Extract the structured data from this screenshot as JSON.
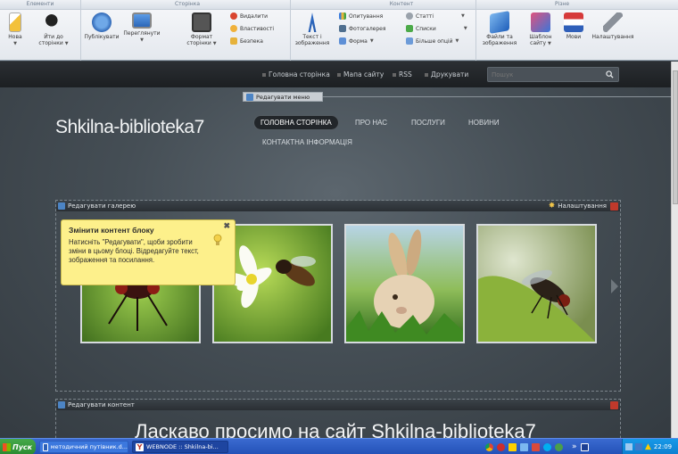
{
  "ribbon": {
    "groups": [
      {
        "label": "Елементи"
      },
      {
        "label": "Сторінка"
      },
      {
        "label": "Контент"
      },
      {
        "label": "Різне"
      }
    ],
    "buttons": {
      "new": "Нова",
      "goto_page": "Йти до сторінки",
      "publish": "Публікувати",
      "preview": "Переглянути",
      "page_format": "Формат сторінки",
      "delete": "Видалити",
      "properties": "Властивості",
      "security": "Безпека",
      "text_images": "Текст і зображення",
      "polls": "Опитування",
      "photogallery": "Фотогалерея",
      "form": "Форма",
      "articles": "Статті",
      "lists": "Списки",
      "more_options": "Більше опцій",
      "files_images": "Файли та зображення",
      "site_template": "Шаблон сайту",
      "languages": "Мови",
      "settings": "Налаштування"
    }
  },
  "site": {
    "toplinks": [
      "Головна сторінка",
      "Мапа сайту",
      "RSS",
      "Друкувати"
    ],
    "search_placeholder": "Пошук",
    "edit_menu": "Редагувати меню",
    "title": "Shkilna-biblioteka7",
    "nav": [
      "ГОЛОВНА СТОРІНКА",
      "ПРО НАС",
      "ПОСЛУГИ",
      "НОВИНИ",
      "КОНТАКТНА ІНФОРМАЦІЯ"
    ],
    "gallery_block": {
      "edit_label": "Редагувати галерею",
      "settings_label": "Налаштування"
    },
    "content_block": {
      "edit_label": "Редагувати контент"
    },
    "tooltip": {
      "title": "Змінити контент блоку",
      "body": "Натисніть \"Редагувати\", щоби зробити зміни в цьому блоці. Відредагуйте текст, зображення та посилання.",
      "close": "✖"
    },
    "welcome": "Ласкаво просимо на сайт Shkilna-biblioteka7"
  },
  "taskbar": {
    "start": "Пуск",
    "tasks": [
      "методичний путівник.d...",
      "WEBNODE :: Shkilna-bi..."
    ],
    "lang": "»",
    "clock": "22:09"
  },
  "colors": {
    "accent": "#2452b8",
    "tooltip_bg": "#fdf08b",
    "close_red": "#c0392b"
  }
}
